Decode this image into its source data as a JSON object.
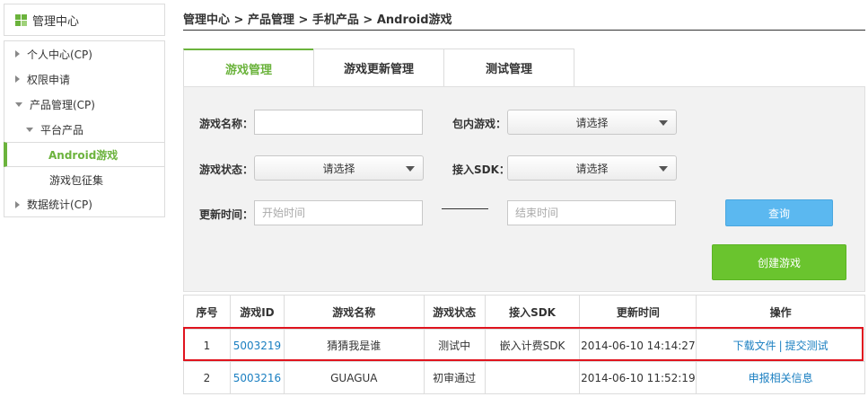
{
  "sidebar": {
    "title": "管理中心",
    "items": [
      {
        "label": "个人中心(CP)"
      },
      {
        "label": "权限申请"
      },
      {
        "label": "产品管理(CP)"
      },
      {
        "label": "平台产品"
      },
      {
        "label": "Android游戏"
      },
      {
        "label": "游戏包征集"
      },
      {
        "label": "数据统计(CP)"
      }
    ]
  },
  "breadcrumb": "管理中心 > 产品管理 > 手机产品 > Android游戏",
  "tabs": [
    {
      "label": "游戏管理",
      "active": true
    },
    {
      "label": "游戏更新管理",
      "active": false
    },
    {
      "label": "测试管理",
      "active": false
    }
  ],
  "form": {
    "game_name_label": "游戏名称：",
    "game_name_value": "",
    "bundled_label": "包内游戏：",
    "bundled_value": "请选择",
    "status_label": "游戏状态：",
    "status_value": "请选择",
    "sdk_label": "接入SDK：",
    "sdk_value": "请选择",
    "update_time_label": "更新时间：",
    "start_placeholder": "开始时间",
    "end_placeholder": "结束时间",
    "query_button": "查询",
    "create_button": "创建游戏"
  },
  "table": {
    "headers": [
      "序号",
      "游戏ID",
      "游戏名称",
      "游戏状态",
      "接入SDK",
      "更新时间",
      "操作"
    ],
    "rows": [
      {
        "index": "1",
        "id": "5003219",
        "name": "猜猜我是谁",
        "status": "测试中",
        "sdk": "嵌入计费SDK",
        "updated": "2014-06-10 14:14:27",
        "actions": [
          "下载文件",
          "提交测试"
        ],
        "separator": "|"
      },
      {
        "index": "2",
        "id": "5003216",
        "name": "GUAGUA",
        "status": "初审通过",
        "sdk": "",
        "updated": "2014-06-10 11:52:19",
        "actions": [
          "申报相关信息"
        ]
      }
    ]
  },
  "colors": {
    "accent_green": "#6bb33c",
    "link_blue": "#1a7fc1",
    "query_blue": "#5bb8f0",
    "create_green": "#6ac42e",
    "highlight_red": "#e0141e"
  }
}
